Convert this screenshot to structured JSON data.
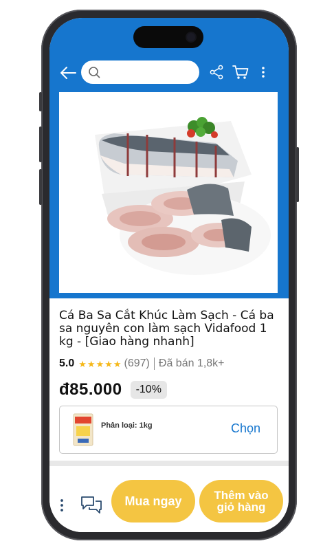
{
  "search": {
    "placeholder": ""
  },
  "product": {
    "title": "Cá Ba Sa Cắt Khúc Làm Sạch - Cá ba sa nguyên con làm sạch Vidafood 1 kg - [Giao hàng nhanh]",
    "rating": "5.0",
    "rating_stars": 5,
    "rating_count": "(697)",
    "sold": "Đã bán 1,8k+",
    "price": "đ85.000",
    "discount": "-10%"
  },
  "variant": {
    "label": "Phân loại: 1kg",
    "choose_label": "Chọn"
  },
  "actions": {
    "buy_now": "Mua ngay",
    "add_to_cart": "Thêm vào giỏ hàng"
  },
  "colors": {
    "brand_blue": "#1676ce",
    "button_yellow": "#f4c542",
    "star_yellow": "#f5b81a"
  },
  "icons": [
    "back-arrow-icon",
    "search-icon",
    "share-icon",
    "cart-icon",
    "more-vertical-icon",
    "chat-icon"
  ]
}
